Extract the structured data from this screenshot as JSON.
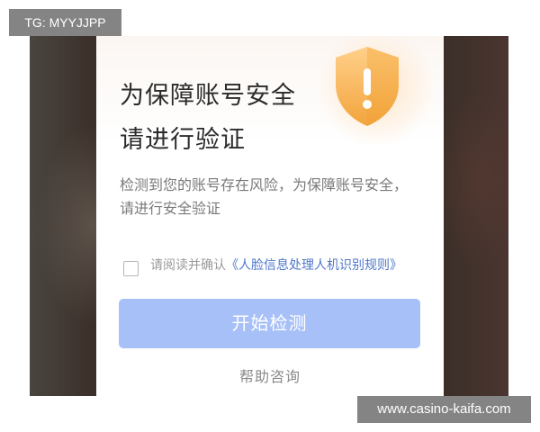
{
  "watermark_top": "TG: MYYJJPP",
  "watermark_bottom": "www.casino-kaifa.com",
  "dialog": {
    "title_line1": "为保障账号安全",
    "title_line2": "请进行验证",
    "description": "检测到您的账号存在风险，为保障账号安全，请进行安全验证",
    "agreement_prefix": "请阅读并确认",
    "agreement_link": "《人脸信息处理人机识别规则》",
    "start_button": "开始检测",
    "help_link": "帮助咨询",
    "shield_icon": "warning-shield-icon",
    "checkbox_checked": false
  },
  "colors": {
    "primary_button": "#a7c0f7",
    "link": "#4f77c9",
    "shield": "#f6b85a"
  }
}
